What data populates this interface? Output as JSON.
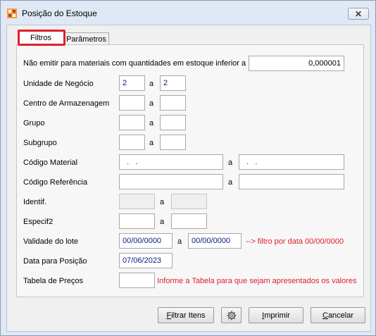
{
  "window": {
    "title": "Posição do Estoque",
    "close_glyph": "✕"
  },
  "tabs": [
    {
      "label": "Filtros"
    },
    {
      "label": "Parâmetros"
    }
  ],
  "min_qty": {
    "label": "Não emitir para materiais com quantidades em estoque inferior a",
    "value": "0,000001"
  },
  "range_separator": "a",
  "unidade": {
    "label": "Unidade de Negócio",
    "from": "2",
    "to": "2"
  },
  "centro": {
    "label": "Centro de Armazenagem",
    "from": "",
    "to": ""
  },
  "grupo": {
    "label": "Grupo",
    "from": "",
    "to": ""
  },
  "subgrupo": {
    "label": "Subgrupo",
    "from": "",
    "to": ""
  },
  "codigo_material": {
    "label": "Código Material",
    "from": "  .   .",
    "to": "  .   ."
  },
  "codigo_referencia": {
    "label": "Código Referência",
    "from": "",
    "to": ""
  },
  "identif": {
    "label": "Identif.",
    "from": "",
    "to": ""
  },
  "especif2": {
    "label": "Especif2",
    "from": "",
    "to": ""
  },
  "validade": {
    "label": "Validade do lote",
    "from": "00/00/0000",
    "to": "00/00/0000",
    "hint": "--> filtro por data 00/00/0000"
  },
  "data_posicao": {
    "label": "Data para Posição",
    "value": "07/06/2023"
  },
  "tabela_precos": {
    "label": "Tabela de Preços",
    "value": "",
    "hint": "Informe a Tabela para que sejam apresentados os valores"
  },
  "buttons": {
    "filtrar_first": "F",
    "filtrar_rest": "iltrar Itens",
    "imprimir_first": "I",
    "imprimir_rest": "mprimir",
    "cancelar_first": "C",
    "cancelar_rest": "ancelar"
  },
  "icons": {
    "app": "app-grid-icon",
    "settings": "gear-icon",
    "close": "close-icon"
  },
  "colors": {
    "hint_red": "#e0202a",
    "tab_highlight": "#e0202a",
    "field_text": "#0a1a7a"
  }
}
